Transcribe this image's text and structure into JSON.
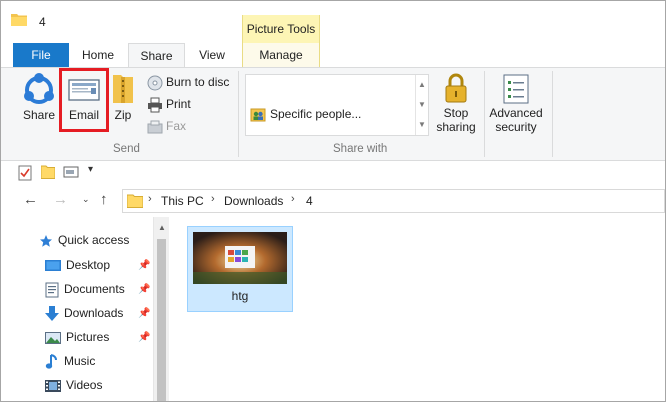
{
  "window": {
    "title": "4",
    "context_tab_group": "Picture Tools"
  },
  "tabs": [
    {
      "label": "File"
    },
    {
      "label": "Home"
    },
    {
      "label": "Share"
    },
    {
      "label": "View"
    },
    {
      "label": "Manage"
    }
  ],
  "ribbon": {
    "send": {
      "group_label": "Send",
      "share": "Share",
      "email": "Email",
      "zip": "Zip",
      "burn": "Burn to disc",
      "print": "Print",
      "fax": "Fax"
    },
    "share_with": {
      "group_label": "Share with",
      "specific_people": "Specific people..."
    },
    "stop_sharing": {
      "line1": "Stop",
      "line2": "sharing"
    },
    "advanced_security": {
      "line1": "Advanced",
      "line2": "security"
    }
  },
  "address_bar": {
    "crumbs": [
      "This PC",
      "Downloads",
      "4"
    ]
  },
  "nav_pane": {
    "quick_access": "Quick access",
    "items": [
      {
        "label": "Desktop",
        "pinned": true
      },
      {
        "label": "Documents",
        "pinned": true
      },
      {
        "label": "Downloads",
        "pinned": true
      },
      {
        "label": "Pictures",
        "pinned": true
      },
      {
        "label": "Music",
        "pinned": false
      },
      {
        "label": "Videos",
        "pinned": false
      }
    ]
  },
  "content": {
    "files": [
      {
        "name": "htg",
        "selected": true
      }
    ]
  },
  "colors": {
    "file_tab": "#1979ca",
    "selection": "#cce8ff",
    "highlight_box": "#e51c23",
    "context_band": "#fdf5b5"
  }
}
